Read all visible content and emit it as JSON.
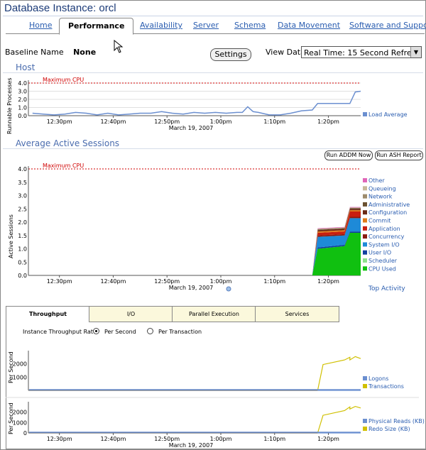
{
  "header": {
    "title": "Database Instance: orcl"
  },
  "tabs": [
    "Home",
    "Performance",
    "Availability",
    "Server",
    "Schema",
    "Data Movement",
    "Software and Support"
  ],
  "baseline": {
    "label": "Baseline Name",
    "value": "None"
  },
  "settings_label": "Settings",
  "view_data": {
    "label": "View Data",
    "selected": "Real Time: 15 Second Refresh"
  },
  "host": {
    "section_title": "Host",
    "ylabel": "Runnable Processes",
    "yticks": [
      "4.0",
      "3.0",
      "2.0",
      "1.0",
      "0.0"
    ],
    "max_cpu_label": "Maximum CPU",
    "legend": [
      "Load Average"
    ]
  },
  "sessions": {
    "section_title": "Average Active Sessions",
    "ylabel": "Active Sessions",
    "yticks": [
      "4.0",
      "3.5",
      "3.0",
      "2.5",
      "2.0",
      "1.5",
      "1.0",
      "0.5",
      "0.0"
    ],
    "max_cpu_label": "Maximum CPU",
    "run_addm": "Run ADDM Now",
    "run_ash": "Run ASH Report",
    "legend": [
      "Other",
      "Queueing",
      "Network",
      "Administrative",
      "Configuration",
      "Commit",
      "Application",
      "Concurrency",
      "System I/O",
      "User I/O",
      "Scheduler",
      "CPU Used"
    ],
    "top_activity": "Top Activity"
  },
  "xaxis": {
    "ticks": [
      "12:30pm",
      "12:40pm",
      "12:50pm",
      "1:00pm",
      "1:10pm",
      "1:20pm"
    ],
    "date": "March 19, 2007"
  },
  "throughput": {
    "tabs": [
      "Throughput",
      "I/O",
      "Parallel Execution",
      "Services"
    ],
    "rate_label": "Instance Throughput Rate",
    "rate_options": [
      "Per Second",
      "Per Transaction"
    ],
    "ylabel": "Per Second",
    "chart1_yticks": [
      "2000",
      "1000"
    ],
    "chart1_legend": [
      "Logons",
      "Transactions"
    ],
    "chart2_yticks": [
      "2000",
      "1000",
      "0"
    ],
    "chart2_legend": [
      "Physical Reads (KB)",
      "Redo Size (KB)"
    ]
  },
  "colors": {
    "load": "#6b8fd0",
    "max_cpu": "#d00000",
    "other": "#e066b8",
    "queueing": "#c8b89a",
    "network": "#9e8c6c",
    "administrative": "#6a5030",
    "configuration": "#6b2a16",
    "commit": "#e07a1a",
    "application": "#c81e10",
    "concurrency": "#8a1b10",
    "system_io": "#1e8ad8",
    "user_io": "#1040a0",
    "scheduler": "#8de28d",
    "cpu_used": "#10c010",
    "transactions": "#d0c000",
    "logons": "#6b8fd0",
    "phys_reads": "#6b8fd0",
    "redo": "#d0c000"
  },
  "chart_data": [
    {
      "type": "line",
      "title": "Host",
      "xlabel": "March 19, 2007",
      "ylabel": "Runnable Processes",
      "ylim": [
        0,
        4
      ],
      "x": [
        "12:25pm",
        "12:27pm",
        "12:29pm",
        "12:31pm",
        "12:33pm",
        "12:35pm",
        "12:37pm",
        "12:39pm",
        "12:41pm",
        "12:43pm",
        "12:45pm",
        "12:47pm",
        "12:49pm",
        "12:51pm",
        "12:53pm",
        "12:55pm",
        "12:57pm",
        "12:59pm",
        "1:01pm",
        "1:03pm",
        "1:04pm",
        "1:05pm",
        "1:06pm",
        "1:07pm",
        "1:09pm",
        "1:11pm",
        "1:13pm",
        "1:15pm",
        "1:17pm",
        "1:18pm",
        "1:20pm",
        "1:22pm",
        "1:24pm",
        "1:25pm",
        "1:26pm"
      ],
      "series": [
        {
          "name": "Load Average",
          "values": [
            0.3,
            0.2,
            0.1,
            0.2,
            0.4,
            0.3,
            0.1,
            0.3,
            0.1,
            0.2,
            0.3,
            0.3,
            0.5,
            0.3,
            0.2,
            0.4,
            0.3,
            0.4,
            0.3,
            0.4,
            0.4,
            1.1,
            0.5,
            0.4,
            0.1,
            0.1,
            0.3,
            0.6,
            0.7,
            1.5,
            1.5,
            1.5,
            1.5,
            2.9,
            3.0
          ]
        }
      ]
    },
    {
      "type": "area",
      "title": "Average Active Sessions",
      "xlabel": "March 19, 2007",
      "ylabel": "Active Sessions",
      "ylim": [
        0,
        4
      ],
      "x": [
        "1:17pm",
        "1:18pm",
        "1:23pm",
        "1:24pm",
        "1:26pm"
      ],
      "series": [
        {
          "name": "CPU Used",
          "values": [
            0,
            1.0,
            1.1,
            1.6,
            1.6
          ]
        },
        {
          "name": "User I/O",
          "values": [
            0,
            0.05,
            0.05,
            0.05,
            0.05
          ]
        },
        {
          "name": "System I/O",
          "values": [
            0,
            0.4,
            0.35,
            0.5,
            0.5
          ]
        },
        {
          "name": "Concurrency",
          "values": [
            0,
            0.05,
            0.05,
            0.05,
            0.05
          ]
        },
        {
          "name": "Application",
          "values": [
            0,
            0.1,
            0.1,
            0.2,
            0.2
          ]
        },
        {
          "name": "Commit",
          "values": [
            0,
            0.05,
            0.05,
            0.05,
            0.05
          ]
        },
        {
          "name": "Configuration",
          "values": [
            0,
            0.05,
            0.05,
            0.05,
            0.05
          ]
        },
        {
          "name": "Administrative",
          "values": [
            0,
            0.02,
            0.02,
            0.02,
            0.02
          ]
        },
        {
          "name": "Network",
          "values": [
            0,
            0.02,
            0.02,
            0.02,
            0.02
          ]
        },
        {
          "name": "Queueing",
          "values": [
            0,
            0.01,
            0.01,
            0.01,
            0.01
          ]
        },
        {
          "name": "Other",
          "values": [
            0,
            0.02,
            0.02,
            0.02,
            0.02
          ]
        }
      ]
    },
    {
      "type": "line",
      "title": "Throughput",
      "ylabel": "Per Second",
      "ylim": [
        0,
        3000
      ],
      "x": [
        "1:18pm",
        "1:19pm",
        "1:23pm",
        "1:24pm",
        "1:24pm",
        "1:25pm",
        "1:26pm"
      ],
      "series": [
        {
          "name": "Transactions",
          "values": [
            0,
            1950,
            2300,
            2500,
            2300,
            2550,
            2400
          ]
        },
        {
          "name": "Logons",
          "values": [
            0,
            0,
            0,
            0,
            0,
            0,
            0
          ]
        }
      ]
    },
    {
      "type": "line",
      "title": "Throughput",
      "ylabel": "Per Second",
      "ylim": [
        0,
        3000
      ],
      "x": [
        "1:18pm",
        "1:19pm",
        "1:23pm",
        "1:24pm",
        "1:24pm",
        "1:25pm",
        "1:26pm"
      ],
      "series": [
        {
          "name": "Redo Size (KB)",
          "values": [
            0,
            1700,
            2150,
            2500,
            2300,
            2550,
            2400
          ]
        },
        {
          "name": "Physical Reads (KB)",
          "values": [
            0,
            0,
            0,
            0,
            0,
            0,
            0
          ]
        }
      ]
    }
  ]
}
